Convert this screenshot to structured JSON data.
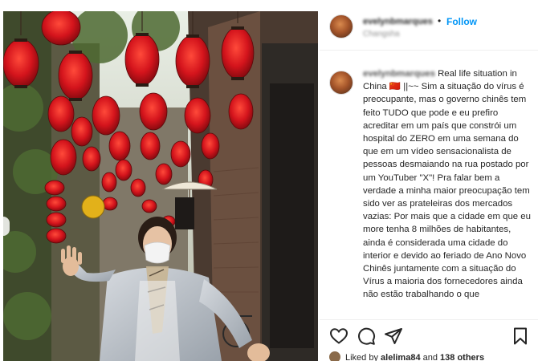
{
  "post": {
    "username": "evelynbmarques",
    "location": "Changsha",
    "follow_label": "Follow",
    "separator": "•",
    "caption_user": "evelynbmarques",
    "caption_text": " Real life situation in China 🇨🇳 ||~~ Sim a situação do vírus é preocupante, mas o governo chinês tem feito TUDO que pode e eu prefiro acreditar em um país que constrói um hospital do ZERO em uma semana do que em um vídeo sensacionalista de pessoas desmaiando na rua postado por um YouTuber \"X\"! Pra falar bem a verdade a minha maior preocupação tem sido ver as prateleiras dos mercados vazias: Por mais que a cidade em que eu more tenha 8 milhões de habitantes, ainda é considerada uma cidade do interior e devido ao feriado de Ano Novo Chinês juntamente com a situação do Vírus a maioria dos fornecedores ainda não estão trabalhando o que",
    "likes_prefix": "Liked by ",
    "likes_user": "alelima84",
    "likes_mid": " and ",
    "likes_count": "138 others"
  },
  "icons": {
    "like": "heart-icon",
    "comment": "comment-icon",
    "share": "paper-plane-icon",
    "save": "bookmark-icon"
  },
  "colors": {
    "accent": "#0095f6",
    "lantern_red": "#d4141c",
    "text": "#262626",
    "muted": "#8e8e8e"
  }
}
